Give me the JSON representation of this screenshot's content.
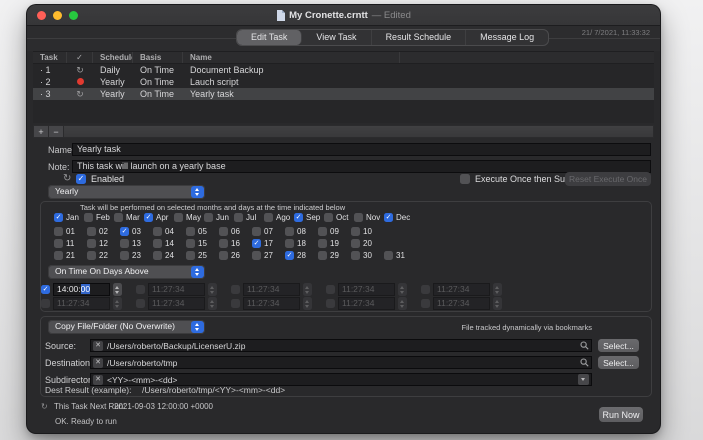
{
  "colors": {
    "accent": "#2e6bdf",
    "selection": "#3466c9",
    "status_red": "#e13a30",
    "traffic_red": "#ff5f57",
    "traffic_yellow": "#febb2e",
    "traffic_green": "#27c83f"
  },
  "icons": {
    "repeat": "↻",
    "clear": "✕"
  },
  "window": {
    "title": "My Cronette.crntt",
    "edited_suffix": "— Edited",
    "timestamp": "21/ 7/2021, 11:33:32"
  },
  "tabs": [
    {
      "label": "Edit Task",
      "selected": true
    },
    {
      "label": "View Task",
      "selected": false
    },
    {
      "label": "Result Schedule",
      "selected": false
    },
    {
      "label": "Message Log",
      "selected": false
    }
  ],
  "task_table": {
    "columns": [
      "Task",
      "✓",
      "Schedule",
      "Basis",
      "Name"
    ],
    "rows": [
      {
        "num": "· 1",
        "status": "repeat",
        "schedule": "Daily",
        "basis": "On Time",
        "name": "Document Backup",
        "selected": false
      },
      {
        "num": "· 2",
        "status": "suspended",
        "schedule": "Yearly",
        "basis": "On Time",
        "name": "Lauch script",
        "selected": false
      },
      {
        "num": "· 3",
        "status": "repeat",
        "schedule": "Yearly",
        "basis": "On Time",
        "name": "Yearly task",
        "selected": true
      }
    ]
  },
  "toolbar": {
    "add_label": "+",
    "remove_label": "−"
  },
  "fields": {
    "name_label": "Name:",
    "name_value": "Yearly task",
    "note_label": "Note:",
    "note_value": "This task will launch on a yearly base"
  },
  "enabled": {
    "label": "Enabled",
    "checked": true,
    "execute_once_label": "Execute Once then Suspend",
    "execute_once_checked": false,
    "reset_button_label": "Reset Execute Once"
  },
  "schedule": {
    "type_popup_value": "Yearly",
    "caption": "Task will be performed on selected months and days at the time indicated below",
    "months": [
      {
        "label": "Jan",
        "checked": true
      },
      {
        "label": "Feb",
        "checked": false
      },
      {
        "label": "Mar",
        "checked": false
      },
      {
        "label": "Apr",
        "checked": true
      },
      {
        "label": "May",
        "checked": false
      },
      {
        "label": "Jun",
        "checked": false
      },
      {
        "label": "Jul",
        "checked": false
      },
      {
        "label": "Ago",
        "checked": false
      },
      {
        "label": "Sep",
        "checked": true
      },
      {
        "label": "Oct",
        "checked": false
      },
      {
        "label": "Nov",
        "checked": false
      },
      {
        "label": "Dec",
        "checked": true
      }
    ],
    "days": [
      {
        "label": "01",
        "checked": false
      },
      {
        "label": "02",
        "checked": false
      },
      {
        "label": "03",
        "checked": true
      },
      {
        "label": "04",
        "checked": false
      },
      {
        "label": "05",
        "checked": false
      },
      {
        "label": "06",
        "checked": false
      },
      {
        "label": "07",
        "checked": false
      },
      {
        "label": "08",
        "checked": false
      },
      {
        "label": "09",
        "checked": false
      },
      {
        "label": "10",
        "checked": false
      },
      {
        "label": "11",
        "checked": false
      },
      {
        "label": "12",
        "checked": false
      },
      {
        "label": "13",
        "checked": false
      },
      {
        "label": "14",
        "checked": false
      },
      {
        "label": "15",
        "checked": false
      },
      {
        "label": "16",
        "checked": false
      },
      {
        "label": "17",
        "checked": true
      },
      {
        "label": "18",
        "checked": false
      },
      {
        "label": "19",
        "checked": false
      },
      {
        "label": "20",
        "checked": false
      },
      {
        "label": "21",
        "checked": false
      },
      {
        "label": "22",
        "checked": false
      },
      {
        "label": "23",
        "checked": false
      },
      {
        "label": "24",
        "checked": false
      },
      {
        "label": "25",
        "checked": false
      },
      {
        "label": "26",
        "checked": false
      },
      {
        "label": "27",
        "checked": false
      },
      {
        "label": "28",
        "checked": true
      },
      {
        "label": "29",
        "checked": false
      },
      {
        "label": "30",
        "checked": false
      },
      {
        "label": "31",
        "checked": false
      }
    ],
    "basis_popup_value": "On Time On Days Above",
    "time_rows": [
      [
        {
          "time": "14:00:",
          "selected_segment": "00",
          "checked": true,
          "enabled": true
        },
        {
          "time": "11:27:34",
          "checked": false,
          "enabled": false
        },
        {
          "time": "11:27:34",
          "checked": false,
          "enabled": false
        },
        {
          "time": "11:27:34",
          "checked": false,
          "enabled": false
        },
        {
          "time": "11:27:34",
          "checked": false,
          "enabled": false
        }
      ],
      [
        {
          "time": "11:27:34",
          "checked": false,
          "enabled": false
        },
        {
          "time": "11:27:34",
          "checked": false,
          "enabled": false
        },
        {
          "time": "11:27:34",
          "checked": false,
          "enabled": false
        },
        {
          "time": "11:27:34",
          "checked": false,
          "enabled": false
        },
        {
          "time": "11:27:34",
          "checked": false,
          "enabled": false
        }
      ]
    ]
  },
  "action": {
    "popup_value": "Copy File/Folder (No Overwrite)",
    "bookmarks_note": "File tracked dynamically via bookmarks",
    "source_label": "Source:",
    "source_value": "/Users/roberto/Backup/LicenserU.zip",
    "destination_label": "Destination:",
    "destination_value": "/Users/roberto/tmp",
    "subdirectory_label": "Subdirectory:",
    "subdirectory_value": "<YY>-<mm>-<dd>",
    "select_button_label": "Select...",
    "dest_result_label": "Dest Result (example):",
    "dest_result_value": "/Users/roberto/tmp/<YY>-<mm>-<dd>"
  },
  "footer": {
    "next_run_label": "This Task Next Run:",
    "next_run_value": "2021-09-03 12:00:00 +0000",
    "status": "OK. Ready to run",
    "run_button_label": "Run Now"
  }
}
